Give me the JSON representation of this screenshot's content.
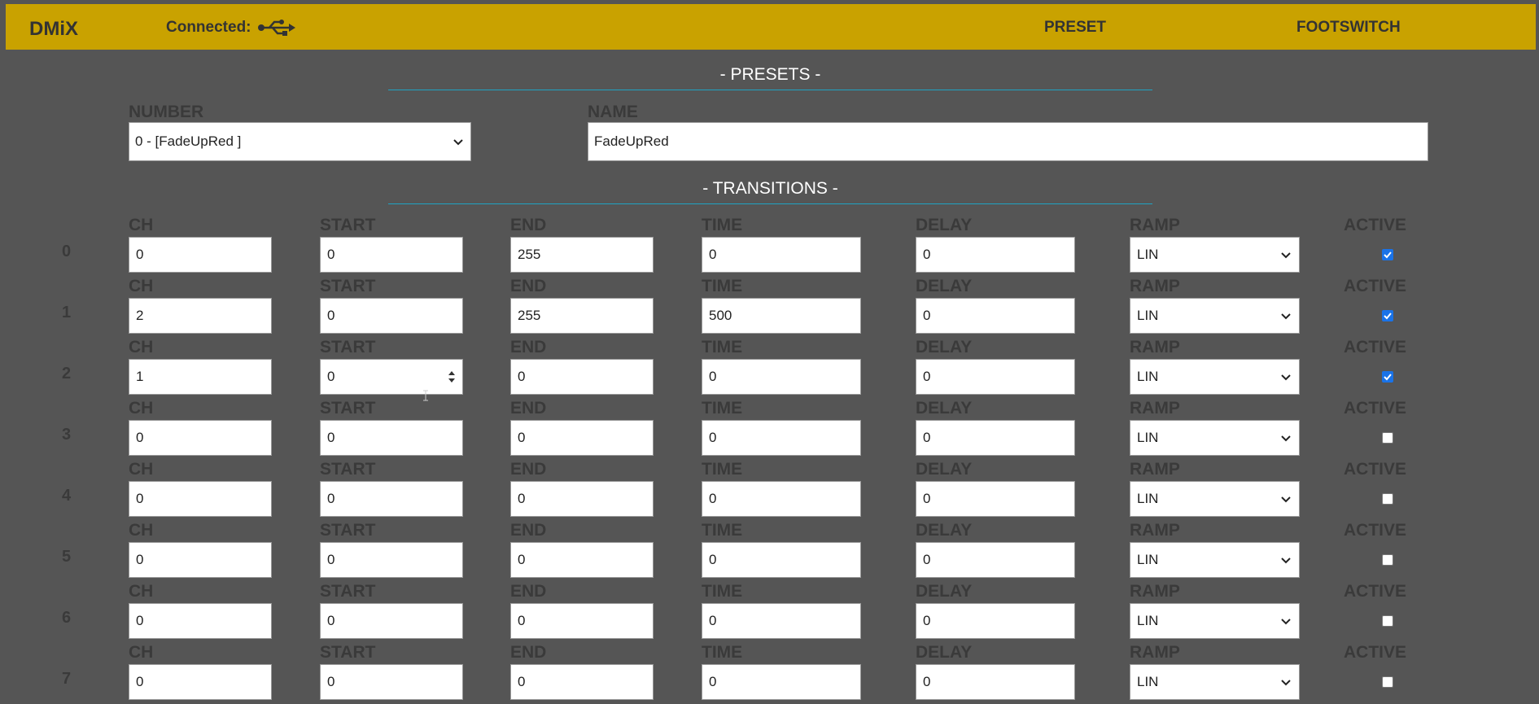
{
  "header": {
    "brand": "DMiX",
    "connection_label": "Connected:",
    "connection_icon": "usb-icon",
    "nav": [
      {
        "label": "PRESET"
      },
      {
        "label": "FOOTSWITCH"
      }
    ],
    "bg_color": "#c9a200"
  },
  "presets": {
    "title": "- PRESETS -",
    "number_label": "NUMBER",
    "number_value": "0 - [FadeUpRed ]",
    "name_label": "NAME",
    "name_value": "FadeUpRed"
  },
  "transitions": {
    "title": "- TRANSITIONS -",
    "columns": [
      "CH",
      "START",
      "END",
      "TIME",
      "DELAY",
      "RAMP",
      "ACTIVE"
    ],
    "rows": [
      {
        "index": "0",
        "ch": "0",
        "start": "0",
        "end": "255",
        "time": "0",
        "delay": "0",
        "ramp": "LIN",
        "active": true
      },
      {
        "index": "1",
        "ch": "2",
        "start": "0",
        "end": "255",
        "time": "500",
        "delay": "0",
        "ramp": "LIN",
        "active": true
      },
      {
        "index": "2",
        "ch": "1",
        "start": "0",
        "end": "0",
        "time": "0",
        "delay": "0",
        "ramp": "LIN",
        "active": true
      },
      {
        "index": "3",
        "ch": "0",
        "start": "0",
        "end": "0",
        "time": "0",
        "delay": "0",
        "ramp": "LIN",
        "active": false
      },
      {
        "index": "4",
        "ch": "0",
        "start": "0",
        "end": "0",
        "time": "0",
        "delay": "0",
        "ramp": "LIN",
        "active": false
      },
      {
        "index": "5",
        "ch": "0",
        "start": "0",
        "end": "0",
        "time": "0",
        "delay": "0",
        "ramp": "LIN",
        "active": false
      },
      {
        "index": "6",
        "ch": "0",
        "start": "0",
        "end": "0",
        "time": "0",
        "delay": "0",
        "ramp": "LIN",
        "active": false
      },
      {
        "index": "7",
        "ch": "0",
        "start": "0",
        "end": "0",
        "time": "0",
        "delay": "0",
        "ramp": "LIN",
        "active": false
      }
    ]
  },
  "colors": {
    "page_bg": "#555555",
    "accent_line": "#1fa3c4",
    "checkbox_on": "#1a73e8"
  }
}
